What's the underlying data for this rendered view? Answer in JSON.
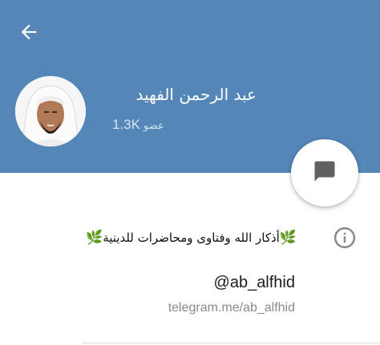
{
  "header": {
    "background_color": "#5486b8",
    "back_icon": "arrow-left-icon",
    "channel_name": "عبد الرحمن الفهيد",
    "member_count": "1.3K",
    "member_word": "عضو",
    "avatar": "channel-avatar-photo"
  },
  "fab": {
    "icon": "message-icon"
  },
  "info": {
    "icon": "info-icon",
    "leaf_emoji": "🌿",
    "description": "أذكار الله وفتاوى ومحاضرات للدينية",
    "username": "@ab_alfhid",
    "link": "telegram.me/ab_alfhid"
  }
}
